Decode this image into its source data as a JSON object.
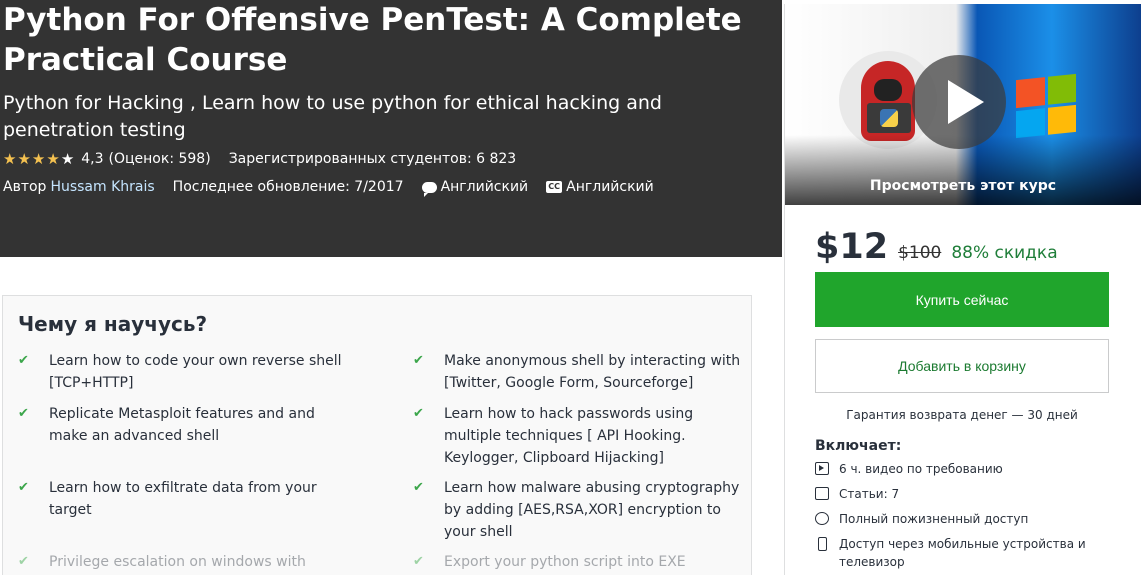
{
  "course": {
    "title": "Python For Offensive PenTest: A Complete Practical Course",
    "subtitle": "Python for Hacking , Learn how to use python for ethical hacking and penetration testing",
    "rating_value": "4,3",
    "rating_count": "(Оценок: 598)",
    "students": "Зарегистрированных студентов: 6 823",
    "author_prefix": "Автор",
    "author_name": "Hussam Khrais",
    "last_update": "Последнее обновление: 7/2017",
    "language": "Английский",
    "captions": "Английский",
    "stars": 4.3
  },
  "preview": {
    "label": "Просмотреть этот курс"
  },
  "pricing": {
    "price": "$12",
    "old_price": "$100",
    "discount": "88% скидка",
    "buy_label": "Купить сейчас",
    "cart_label": "Добавить в корзину",
    "guarantee": "Гарантия возврата денег — 30 дней"
  },
  "includes": {
    "title": "Включает:",
    "items": [
      "6 ч. видео по требованию",
      "Статьи: 7",
      "Полный пожизненный доступ",
      "Доступ через мобильные устройства и телевизор"
    ]
  },
  "learn": {
    "title": "Чему я научусь?",
    "items": [
      "Learn how to code your own reverse shell [TCP+HTTP]",
      "Make anonymous shell by interacting with [Twitter, Google Form, Sourceforge]",
      "Replicate Metasploit features and and make an advanced shell",
      "Learn how to hack passwords using multiple techniques [ API Hooking. Keylogger, Clipboard Hijacking]",
      "Learn how to exfiltrate data from your target",
      "Learn how malware abusing cryptography by adding [AES,RSA,XOR] encryption to your shell",
      "Privilege escalation on windows with",
      "Export your python script into EXE"
    ]
  }
}
